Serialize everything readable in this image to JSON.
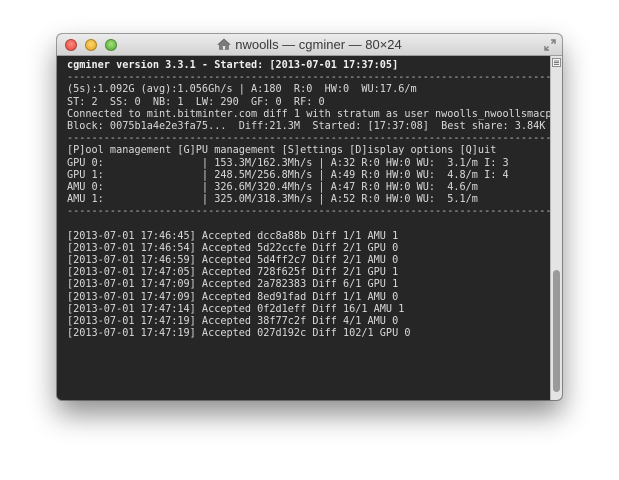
{
  "window": {
    "title": "nwoolls — cgminer — 80×24"
  },
  "terminal": {
    "header": "cgminer version 3.3.1 - Started: [2013-07-01 17:37:05]",
    "separator": "--------------------------------------------------------------------------------",
    "stats1": "(5s):1.092G (avg):1.056Gh/s | A:180  R:0  HW:0  WU:17.6/m",
    "stats2": "ST: 2  SS: 0  NB: 1  LW: 290  GF: 0  RF: 0",
    "connection": "Connected to mint.bitminter.com diff 1 with stratum as user nwoolls_nwoollsmacp",
    "block": "Block: 0075b1a4e2e3fa75...  Diff:21.3M  Started: [17:37:08]  Best share: 3.84K",
    "menu": "[P]ool management [G]PU management [S]ettings [D]isplay options [Q]uit",
    "devices": [
      "GPU 0:                | 153.3M/162.3Mh/s | A:32 R:0 HW:0 WU:  3.1/m I: 3",
      "GPU 1:                | 248.5M/256.8Mh/s | A:49 R:0 HW:0 WU:  4.8/m I: 4",
      "AMU 0:                | 326.6M/320.4Mh/s | A:47 R:0 HW:0 WU:  4.6/m",
      "AMU 1:                | 325.0M/318.3Mh/s | A:52 R:0 HW:0 WU:  5.1/m"
    ],
    "log": [
      "[2013-07-01 17:46:45] Accepted dcc8a88b Diff 1/1 AMU 1",
      "[2013-07-01 17:46:54] Accepted 5d22ccfe Diff 2/1 GPU 0",
      "[2013-07-01 17:46:59] Accepted 5d4ff2c7 Diff 2/1 AMU 0",
      "[2013-07-01 17:47:05] Accepted 728f625f Diff 2/1 GPU 1",
      "[2013-07-01 17:47:09] Accepted 2a782383 Diff 6/1 GPU 1",
      "[2013-07-01 17:47:09] Accepted 8ed91fad Diff 1/1 AMU 0",
      "[2013-07-01 17:47:14] Accepted 0f2d1eff Diff 16/1 AMU 1",
      "[2013-07-01 17:47:19] Accepted 38f77c2f Diff 4/1 AMU 0",
      "[2013-07-01 17:47:19] Accepted 027d192c Diff 102/1 GPU 0"
    ]
  },
  "icons": {
    "close": "close-button",
    "minimize": "minimize-button",
    "zoom": "zoom-button",
    "home": "home-icon",
    "fullscreen": "fullscreen-icon",
    "scroll_menu": "list-icon"
  },
  "colors": {
    "terminal_bg": "#262626",
    "terminal_fg": "#d9d9d9",
    "close": "#e0443a",
    "minimize": "#e0a020",
    "zoom": "#4caa32"
  }
}
